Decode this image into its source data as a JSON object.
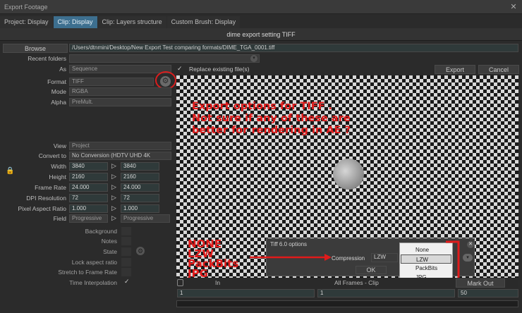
{
  "window": {
    "title": "Export Footage"
  },
  "tabs": [
    {
      "label": "Project: Display",
      "active": false
    },
    {
      "label": "Clip: Display",
      "active": true
    },
    {
      "label": "Clip: Layers structure",
      "active": false
    },
    {
      "label": "Custom Brush: Display",
      "active": false
    }
  ],
  "header": {
    "title": "dime export setting TIFF"
  },
  "browse": {
    "label": "Browse",
    "path": "/Users/dtnmini/Desktop/New Export Test comparing formats/DIME_TGA_0001.tiff"
  },
  "recent": {
    "label": "Recent folders"
  },
  "as": {
    "label": "As",
    "value": "Sequence",
    "replace_label": "Replace existing file(s)"
  },
  "actions": {
    "export": "Export",
    "cancel": "Cancel"
  },
  "format": {
    "format_label": "Format",
    "format_value": "TIFF",
    "mode_label": "Mode",
    "mode_value": "RGBA",
    "alpha_label": "Alpha",
    "alpha_value": "PreMult."
  },
  "annotation": {
    "line1": "Export options for TIFF .",
    "line2": "Not sure if any of these are",
    "line3": "better for rendering in AE ?",
    "list": [
      "NONE",
      "LZW",
      "PackBits",
      "JPG"
    ]
  },
  "settings": {
    "view_label": "View",
    "view_value": "Project",
    "convert_label": "Convert to",
    "convert_value": "No Conversion (HDTV UHD 4K",
    "width_label": "Width",
    "width_a": "3840",
    "width_b": "3840",
    "height_label": "Height",
    "height_a": "2160",
    "height_b": "2160",
    "framerate_label": "Frame Rate",
    "framerate_a": "24.000",
    "framerate_b": "24.000",
    "dpi_label": "DPI Resolution",
    "dpi_a": "72",
    "dpi_b": "72",
    "par_label": "Pixel Aspect Ratio",
    "par_a": "1.000",
    "par_b": "1.000",
    "field_label": "Field",
    "field_a": "Progressive",
    "field_b": "Progressive"
  },
  "options": {
    "background": "Background",
    "notes": "Notes",
    "state": "State",
    "lock_aspect": "Lock aspect ratio",
    "stretch": "Stretch to Frame Rate",
    "time_interp": "Time Interpolation"
  },
  "tiff_dialog": {
    "title": "Tiff 6.0 options",
    "compression_label": "Compression",
    "compression_value": "LZW",
    "ok": "OK",
    "options": [
      "None",
      "LZW",
      "PackBits",
      "JPG"
    ]
  },
  "timeline": {
    "in_label": "In",
    "range_label": "All Frames - Clip",
    "out_label": "Mark Out",
    "in_value": "1",
    "mid_value": "1",
    "out_value": "50"
  },
  "colors": {
    "accent": "#3d6f8f",
    "annotation": "#e01b1b"
  }
}
